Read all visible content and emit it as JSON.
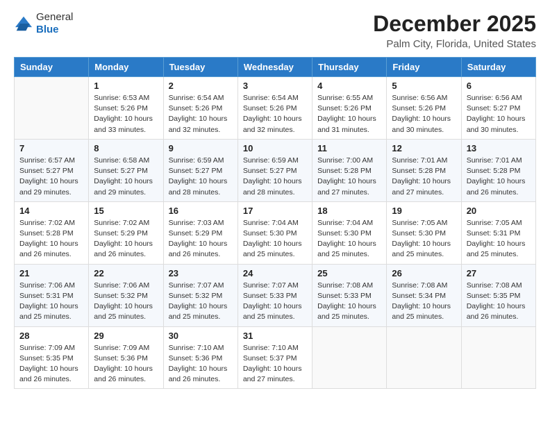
{
  "header": {
    "logo_general": "General",
    "logo_blue": "Blue",
    "month_title": "December 2025",
    "location": "Palm City, Florida, United States"
  },
  "days_of_week": [
    "Sunday",
    "Monday",
    "Tuesday",
    "Wednesday",
    "Thursday",
    "Friday",
    "Saturday"
  ],
  "weeks": [
    [
      {
        "day": "",
        "info": ""
      },
      {
        "day": "1",
        "info": "Sunrise: 6:53 AM\nSunset: 5:26 PM\nDaylight: 10 hours\nand 33 minutes."
      },
      {
        "day": "2",
        "info": "Sunrise: 6:54 AM\nSunset: 5:26 PM\nDaylight: 10 hours\nand 32 minutes."
      },
      {
        "day": "3",
        "info": "Sunrise: 6:54 AM\nSunset: 5:26 PM\nDaylight: 10 hours\nand 32 minutes."
      },
      {
        "day": "4",
        "info": "Sunrise: 6:55 AM\nSunset: 5:26 PM\nDaylight: 10 hours\nand 31 minutes."
      },
      {
        "day": "5",
        "info": "Sunrise: 6:56 AM\nSunset: 5:26 PM\nDaylight: 10 hours\nand 30 minutes."
      },
      {
        "day": "6",
        "info": "Sunrise: 6:56 AM\nSunset: 5:27 PM\nDaylight: 10 hours\nand 30 minutes."
      }
    ],
    [
      {
        "day": "7",
        "info": "Sunrise: 6:57 AM\nSunset: 5:27 PM\nDaylight: 10 hours\nand 29 minutes."
      },
      {
        "day": "8",
        "info": "Sunrise: 6:58 AM\nSunset: 5:27 PM\nDaylight: 10 hours\nand 29 minutes."
      },
      {
        "day": "9",
        "info": "Sunrise: 6:59 AM\nSunset: 5:27 PM\nDaylight: 10 hours\nand 28 minutes."
      },
      {
        "day": "10",
        "info": "Sunrise: 6:59 AM\nSunset: 5:27 PM\nDaylight: 10 hours\nand 28 minutes."
      },
      {
        "day": "11",
        "info": "Sunrise: 7:00 AM\nSunset: 5:28 PM\nDaylight: 10 hours\nand 27 minutes."
      },
      {
        "day": "12",
        "info": "Sunrise: 7:01 AM\nSunset: 5:28 PM\nDaylight: 10 hours\nand 27 minutes."
      },
      {
        "day": "13",
        "info": "Sunrise: 7:01 AM\nSunset: 5:28 PM\nDaylight: 10 hours\nand 26 minutes."
      }
    ],
    [
      {
        "day": "14",
        "info": "Sunrise: 7:02 AM\nSunset: 5:28 PM\nDaylight: 10 hours\nand 26 minutes."
      },
      {
        "day": "15",
        "info": "Sunrise: 7:02 AM\nSunset: 5:29 PM\nDaylight: 10 hours\nand 26 minutes."
      },
      {
        "day": "16",
        "info": "Sunrise: 7:03 AM\nSunset: 5:29 PM\nDaylight: 10 hours\nand 26 minutes."
      },
      {
        "day": "17",
        "info": "Sunrise: 7:04 AM\nSunset: 5:30 PM\nDaylight: 10 hours\nand 25 minutes."
      },
      {
        "day": "18",
        "info": "Sunrise: 7:04 AM\nSunset: 5:30 PM\nDaylight: 10 hours\nand 25 minutes."
      },
      {
        "day": "19",
        "info": "Sunrise: 7:05 AM\nSunset: 5:30 PM\nDaylight: 10 hours\nand 25 minutes."
      },
      {
        "day": "20",
        "info": "Sunrise: 7:05 AM\nSunset: 5:31 PM\nDaylight: 10 hours\nand 25 minutes."
      }
    ],
    [
      {
        "day": "21",
        "info": "Sunrise: 7:06 AM\nSunset: 5:31 PM\nDaylight: 10 hours\nand 25 minutes."
      },
      {
        "day": "22",
        "info": "Sunrise: 7:06 AM\nSunset: 5:32 PM\nDaylight: 10 hours\nand 25 minutes."
      },
      {
        "day": "23",
        "info": "Sunrise: 7:07 AM\nSunset: 5:32 PM\nDaylight: 10 hours\nand 25 minutes."
      },
      {
        "day": "24",
        "info": "Sunrise: 7:07 AM\nSunset: 5:33 PM\nDaylight: 10 hours\nand 25 minutes."
      },
      {
        "day": "25",
        "info": "Sunrise: 7:08 AM\nSunset: 5:33 PM\nDaylight: 10 hours\nand 25 minutes."
      },
      {
        "day": "26",
        "info": "Sunrise: 7:08 AM\nSunset: 5:34 PM\nDaylight: 10 hours\nand 25 minutes."
      },
      {
        "day": "27",
        "info": "Sunrise: 7:08 AM\nSunset: 5:35 PM\nDaylight: 10 hours\nand 26 minutes."
      }
    ],
    [
      {
        "day": "28",
        "info": "Sunrise: 7:09 AM\nSunset: 5:35 PM\nDaylight: 10 hours\nand 26 minutes."
      },
      {
        "day": "29",
        "info": "Sunrise: 7:09 AM\nSunset: 5:36 PM\nDaylight: 10 hours\nand 26 minutes."
      },
      {
        "day": "30",
        "info": "Sunrise: 7:10 AM\nSunset: 5:36 PM\nDaylight: 10 hours\nand 26 minutes."
      },
      {
        "day": "31",
        "info": "Sunrise: 7:10 AM\nSunset: 5:37 PM\nDaylight: 10 hours\nand 27 minutes."
      },
      {
        "day": "",
        "info": ""
      },
      {
        "day": "",
        "info": ""
      },
      {
        "day": "",
        "info": ""
      }
    ]
  ]
}
